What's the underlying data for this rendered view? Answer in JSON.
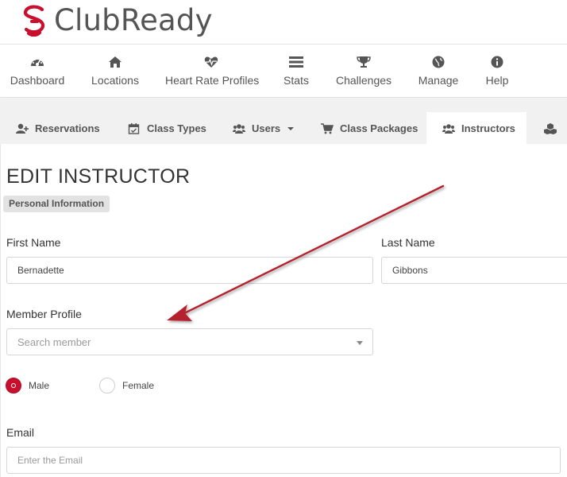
{
  "brand": {
    "name": "ClubReady",
    "color": "#c8102e"
  },
  "nav": {
    "items": [
      {
        "label": "Dashboard",
        "icon": "dashboard-icon"
      },
      {
        "label": "Locations",
        "icon": "home-icon"
      },
      {
        "label": "Heart Rate Profiles",
        "icon": "heart-rate-icon"
      },
      {
        "label": "Stats",
        "icon": "stats-icon"
      },
      {
        "label": "Challenges",
        "icon": "trophy-icon"
      },
      {
        "label": "Manage",
        "icon": "globe-icon"
      },
      {
        "label": "Help",
        "icon": "info-icon"
      }
    ]
  },
  "tabs": {
    "items": [
      {
        "label": "Reservations",
        "icon": "user-plus-icon"
      },
      {
        "label": "Class Types",
        "icon": "calendar-check-icon"
      },
      {
        "label": "Users",
        "icon": "users-icon"
      },
      {
        "label": "Class Packages",
        "icon": "cart-icon"
      },
      {
        "label": "Instructors",
        "icon": "users-icon"
      },
      {
        "label": "",
        "icon": "cubes-icon"
      }
    ],
    "active": "Instructors"
  },
  "form": {
    "title": "EDIT INSTRUCTOR",
    "section": "Personal Information",
    "first_name_label": "First Name",
    "first_name_value": "Bernadette",
    "last_name_label": "Last Name",
    "last_name_value": "Gibbons",
    "member_profile_label": "Member Profile",
    "member_profile_placeholder": "Search member",
    "gender": {
      "male": "Male",
      "female": "Female",
      "selected": "Male"
    },
    "email_label": "Email",
    "email_placeholder": "Enter the Email"
  },
  "annotation": {
    "arrow_color": "#b5202d"
  }
}
